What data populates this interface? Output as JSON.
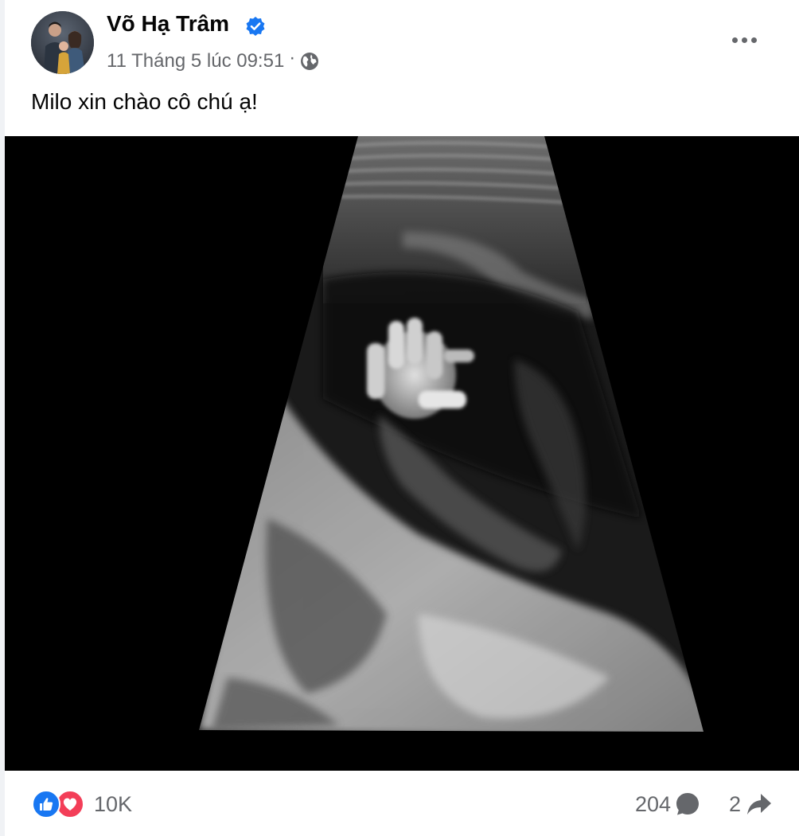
{
  "post": {
    "author": "Võ Hạ Trâm",
    "timestamp": "11 Tháng 5 lúc 09:51",
    "separator": "·",
    "privacy_icon": "globe-icon",
    "verified_icon": "verified-badge-icon",
    "text": "Milo xin chào cô chú ạ!"
  },
  "stats": {
    "reactions_count": "10K",
    "reaction_icons": [
      "like-reaction-icon",
      "love-reaction-icon"
    ],
    "comments_count": "204",
    "shares_count": "2"
  },
  "colors": {
    "verified": "#1877f2",
    "like": "#1877f2",
    "love": "#f33e58",
    "secondary_text": "#65676b"
  }
}
